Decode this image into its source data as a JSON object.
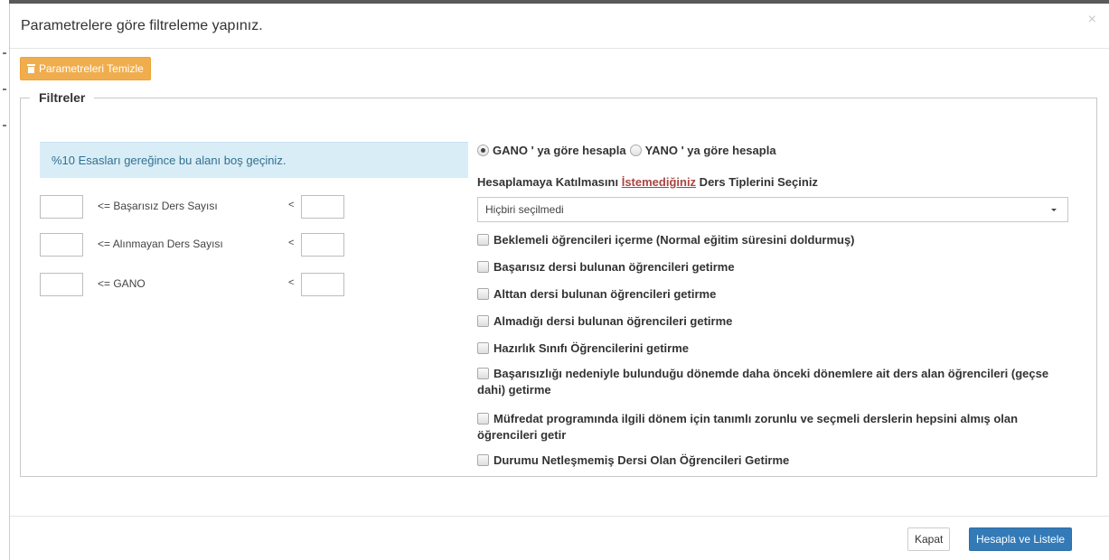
{
  "modal": {
    "title": "Parametrelere göre filtreleme yapınız.",
    "close_symbol": "×"
  },
  "toolbar": {
    "clear_label": "Parametreleri Temizle",
    "clear_icon": "trash-icon"
  },
  "filters": {
    "legend": "Filtreler",
    "info": "%10 Esasları gereğince bu alanı boş geçiniz.",
    "rows": [
      {
        "label": "<= Başarısız Ders Sayısı",
        "lt": "<",
        "min": "",
        "max": ""
      },
      {
        "label": "<= Alınmayan Ders Sayısı",
        "lt": "<",
        "min": "",
        "max": ""
      },
      {
        "label": "<= GANO",
        "lt": "<",
        "min": "",
        "max": ""
      }
    ],
    "calc_options": [
      {
        "label": "GANO ' ya göre hesapla",
        "checked": true
      },
      {
        "label": "YANO ' ya göre hesapla",
        "checked": false
      }
    ],
    "course_types": {
      "label_before": "Hesaplamaya Katılmasını ",
      "label_link": "İstemediğiniz",
      "label_after": " Ders Tiplerini Seçiniz",
      "selected": "Hiçbiri seçilmedi"
    },
    "checkboxes": [
      {
        "label": "Beklemeli öğrencileri içerme (Normal eğitim süresini doldurmuş)",
        "checked": false
      },
      {
        "label": "Başarısız dersi bulunan öğrencileri getirme",
        "checked": false
      },
      {
        "label": "Alttan dersi bulunan öğrencileri getirme",
        "checked": false
      },
      {
        "label": "Almadığı dersi bulunan öğrencileri getirme",
        "checked": false
      },
      {
        "label": "Hazırlık Sınıfı Öğrencilerini getirme",
        "checked": false
      },
      {
        "label": "Başarısızlığı nedeniyle bulunduğu dönemde daha önceki dönemlere ait ders alan öğrencileri (geçse dahi) getirme",
        "checked": false
      },
      {
        "label": "Müfredat programında ilgili dönem için tanımlı zorunlu ve seçmeli derslerin hepsini almış olan öğrencileri getir",
        "checked": false
      },
      {
        "label": "Durumu Netleşmemiş Dersi Olan Öğrencileri Getirme",
        "checked": false
      }
    ]
  },
  "footer": {
    "close_label": "Kapat",
    "submit_label": "Hesapla ve Listele"
  },
  "colors": {
    "warning": "#f0ad4e",
    "primary": "#337ab7",
    "info_bg": "#d9edf7",
    "link": "#a94442"
  }
}
